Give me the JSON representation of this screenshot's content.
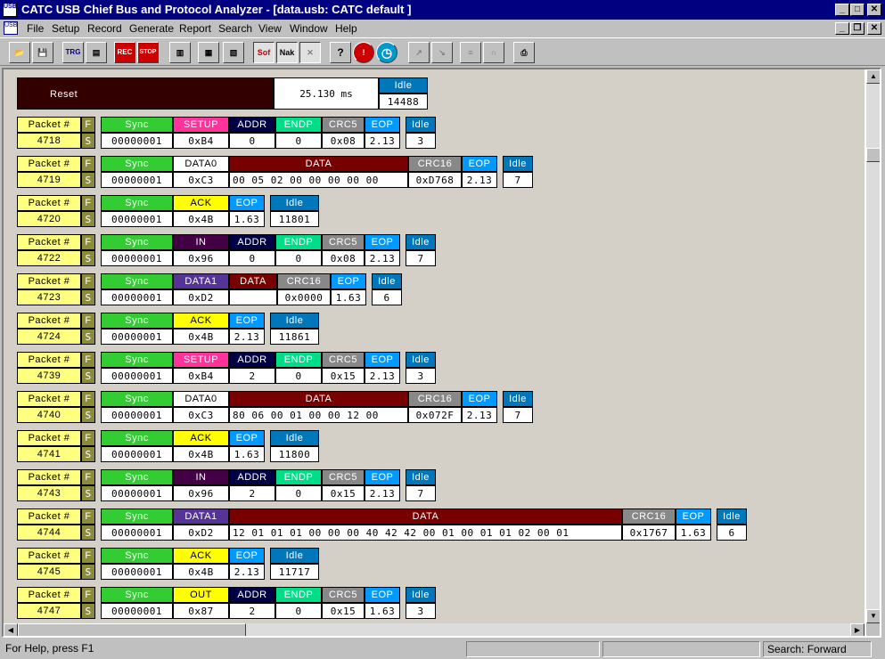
{
  "app": {
    "title": "CATC USB Chief Bus and Protocol Analyzer - [data.usb: CATC default ]",
    "icon_text": "USB"
  },
  "menu": [
    "File",
    "Setup",
    "Record",
    "Generate",
    "Report",
    "Search",
    "View",
    "Window",
    "Help"
  ],
  "toolbar": {
    "buttons": [
      {
        "name": "open-icon",
        "label": "📂"
      },
      {
        "name": "save-icon",
        "label": "💾"
      },
      {
        "name": "trigger-icon",
        "label": "TRG"
      },
      {
        "name": "filter-icon",
        "label": "▤"
      },
      {
        "name": "record-icon",
        "label": "REC"
      },
      {
        "name": "stop-icon",
        "label": "STOP"
      },
      {
        "name": "report-icon",
        "label": "▥"
      },
      {
        "name": "bus-util-icon",
        "label": "▦"
      },
      {
        "name": "export-icon",
        "label": "▧"
      },
      {
        "name": "hide-sof-icon",
        "label": "Sof"
      },
      {
        "name": "hide-nak-icon",
        "label": "Nak"
      },
      {
        "name": "hide-chirp-icon",
        "label": "✕"
      },
      {
        "name": "help-icon",
        "label": "?"
      },
      {
        "name": "error-icon",
        "label": "!"
      },
      {
        "name": "timing-icon",
        "label": "◷"
      },
      {
        "name": "marker-icon",
        "label": "↗"
      },
      {
        "name": "mark-clear-icon",
        "label": "↘"
      },
      {
        "name": "expand-icon",
        "label": "≡"
      },
      {
        "name": "collapse-icon",
        "label": "∩"
      },
      {
        "name": "print-icon",
        "label": "⎙"
      }
    ]
  },
  "reset": {
    "label": "Reset",
    "time": "25.130 ms",
    "idle_label": "Idle",
    "idle_value": "14488"
  },
  "packets": [
    {
      "num": "4718",
      "fields": [
        [
          "Sync",
          "00000001",
          "sync"
        ],
        [
          "SETUP",
          "0xB4",
          "setup"
        ],
        [
          "ADDR",
          "0",
          "addr"
        ],
        [
          "ENDP",
          "0",
          "endp"
        ],
        [
          "CRC5",
          "0x08",
          "crc"
        ],
        [
          "EOP",
          "2.13",
          "eop"
        ],
        [
          "Idle",
          "3",
          "idle"
        ]
      ]
    },
    {
      "num": "4719",
      "fields": [
        [
          "Sync",
          "00000001",
          "sync"
        ],
        [
          "DATA0",
          "0xC3",
          "data0"
        ],
        [
          "DATA",
          "00 05 02 00 00 00 00 00",
          "datapl"
        ],
        [
          "CRC16",
          "0xD768",
          "crc"
        ],
        [
          "EOP",
          "2.13",
          "eop"
        ],
        [
          "Idle",
          "7",
          "idle"
        ]
      ]
    },
    {
      "num": "4720",
      "fields": [
        [
          "Sync",
          "00000001",
          "sync"
        ],
        [
          "ACK",
          "0x4B",
          "ack"
        ],
        [
          "EOP",
          "1.63",
          "eop"
        ],
        [
          "Idle",
          "11801",
          "idle"
        ]
      ]
    },
    {
      "num": "4722",
      "fields": [
        [
          "Sync",
          "00000001",
          "sync"
        ],
        [
          "IN",
          "0x96",
          "in"
        ],
        [
          "ADDR",
          "0",
          "addr"
        ],
        [
          "ENDP",
          "0",
          "endp"
        ],
        [
          "CRC5",
          "0x08",
          "crc"
        ],
        [
          "EOP",
          "2.13",
          "eop"
        ],
        [
          "Idle",
          "7",
          "idle"
        ]
      ]
    },
    {
      "num": "4723",
      "fields": [
        [
          "Sync",
          "00000001",
          "sync"
        ],
        [
          "DATA1",
          "0xD2",
          "data1"
        ],
        [
          "DATA",
          "",
          "datapl"
        ],
        [
          "CRC16",
          "0x0000",
          "crc"
        ],
        [
          "EOP",
          "1.63",
          "eop"
        ],
        [
          "Idle",
          "6",
          "idle"
        ]
      ]
    },
    {
      "num": "4724",
      "fields": [
        [
          "Sync",
          "00000001",
          "sync"
        ],
        [
          "ACK",
          "0x4B",
          "ack"
        ],
        [
          "EOP",
          "2.13",
          "eop"
        ],
        [
          "Idle",
          "11861",
          "idle"
        ]
      ]
    },
    {
      "num": "4739",
      "fields": [
        [
          "Sync",
          "00000001",
          "sync"
        ],
        [
          "SETUP",
          "0xB4",
          "setup"
        ],
        [
          "ADDR",
          "2",
          "addr"
        ],
        [
          "ENDP",
          "0",
          "endp"
        ],
        [
          "CRC5",
          "0x15",
          "crc"
        ],
        [
          "EOP",
          "2.13",
          "eop"
        ],
        [
          "Idle",
          "3",
          "idle"
        ]
      ]
    },
    {
      "num": "4740",
      "fields": [
        [
          "Sync",
          "00000001",
          "sync"
        ],
        [
          "DATA0",
          "0xC3",
          "data0"
        ],
        [
          "DATA",
          "80 06 00 01 00 00 12 00",
          "datapl"
        ],
        [
          "CRC16",
          "0x072F",
          "crc"
        ],
        [
          "EOP",
          "2.13",
          "eop"
        ],
        [
          "Idle",
          "7",
          "idle"
        ]
      ]
    },
    {
      "num": "4741",
      "fields": [
        [
          "Sync",
          "00000001",
          "sync"
        ],
        [
          "ACK",
          "0x4B",
          "ack"
        ],
        [
          "EOP",
          "1.63",
          "eop"
        ],
        [
          "Idle",
          "11800",
          "idle"
        ]
      ]
    },
    {
      "num": "4743",
      "fields": [
        [
          "Sync",
          "00000001",
          "sync"
        ],
        [
          "IN",
          "0x96",
          "in"
        ],
        [
          "ADDR",
          "2",
          "addr"
        ],
        [
          "ENDP",
          "0",
          "endp"
        ],
        [
          "CRC5",
          "0x15",
          "crc"
        ],
        [
          "EOP",
          "2.13",
          "eop"
        ],
        [
          "Idle",
          "7",
          "idle"
        ]
      ]
    },
    {
      "num": "4744",
      "fields": [
        [
          "Sync",
          "00000001",
          "sync"
        ],
        [
          "DATA1",
          "0xD2",
          "data1"
        ],
        [
          "DATA",
          "12 01 01 01 00 00 00 40 42 42 00 01 00 01 01 02 00 01",
          "datapl"
        ],
        [
          "CRC16",
          "0x1767",
          "crc"
        ],
        [
          "EOP",
          "1.63",
          "eop"
        ],
        [
          "Idle",
          "6",
          "idle"
        ]
      ]
    },
    {
      "num": "4745",
      "fields": [
        [
          "Sync",
          "00000001",
          "sync"
        ],
        [
          "ACK",
          "0x4B",
          "ack"
        ],
        [
          "EOP",
          "2.13",
          "eop"
        ],
        [
          "Idle",
          "11717",
          "idle"
        ]
      ]
    },
    {
      "num": "4747",
      "fields": [
        [
          "Sync",
          "00000001",
          "sync"
        ],
        [
          "OUT",
          "0x87",
          "out"
        ],
        [
          "ADDR",
          "2",
          "addr"
        ],
        [
          "ENDP",
          "0",
          "endp"
        ],
        [
          "CRC5",
          "0x15",
          "crc"
        ],
        [
          "EOP",
          "1.63",
          "eop"
        ],
        [
          "Idle",
          "3",
          "idle"
        ]
      ]
    }
  ],
  "packet_header_label": "Packet #",
  "f_label": "F",
  "s_label": "S",
  "status": {
    "help": "For Help, press F1",
    "search": "Search: Forward"
  }
}
